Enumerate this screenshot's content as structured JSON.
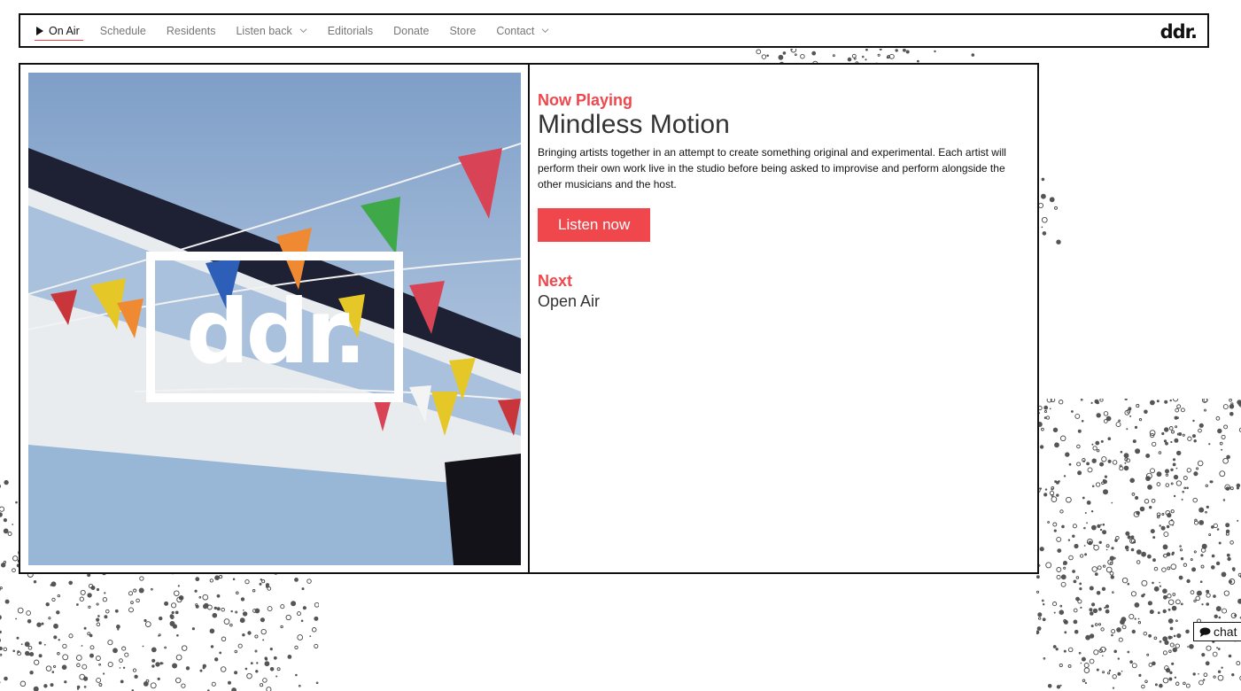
{
  "nav": {
    "items": [
      {
        "label": "On Air",
        "active": true,
        "icon": "play-icon"
      },
      {
        "label": "Schedule"
      },
      {
        "label": "Residents"
      },
      {
        "label": "Listen back",
        "dropdown": true
      },
      {
        "label": "Editorials"
      },
      {
        "label": "Donate"
      },
      {
        "label": "Store"
      },
      {
        "label": "Contact",
        "dropdown": true
      }
    ],
    "logo": "ddr."
  },
  "artwork": {
    "logo_text": "ddr."
  },
  "now_playing": {
    "label": "Now Playing",
    "title": "Mindless Motion",
    "description": "Bringing artists together in an attempt to create something original and experimental. Each artist will perform their own work live in the studio before being asked to improvise and perform alongside the other musicians and the host.",
    "button": "Listen now"
  },
  "next": {
    "label": "Next",
    "show": "Open Air"
  },
  "chat": {
    "label": "chat"
  },
  "colors": {
    "accent": "#f0474c",
    "border": "#111111"
  }
}
